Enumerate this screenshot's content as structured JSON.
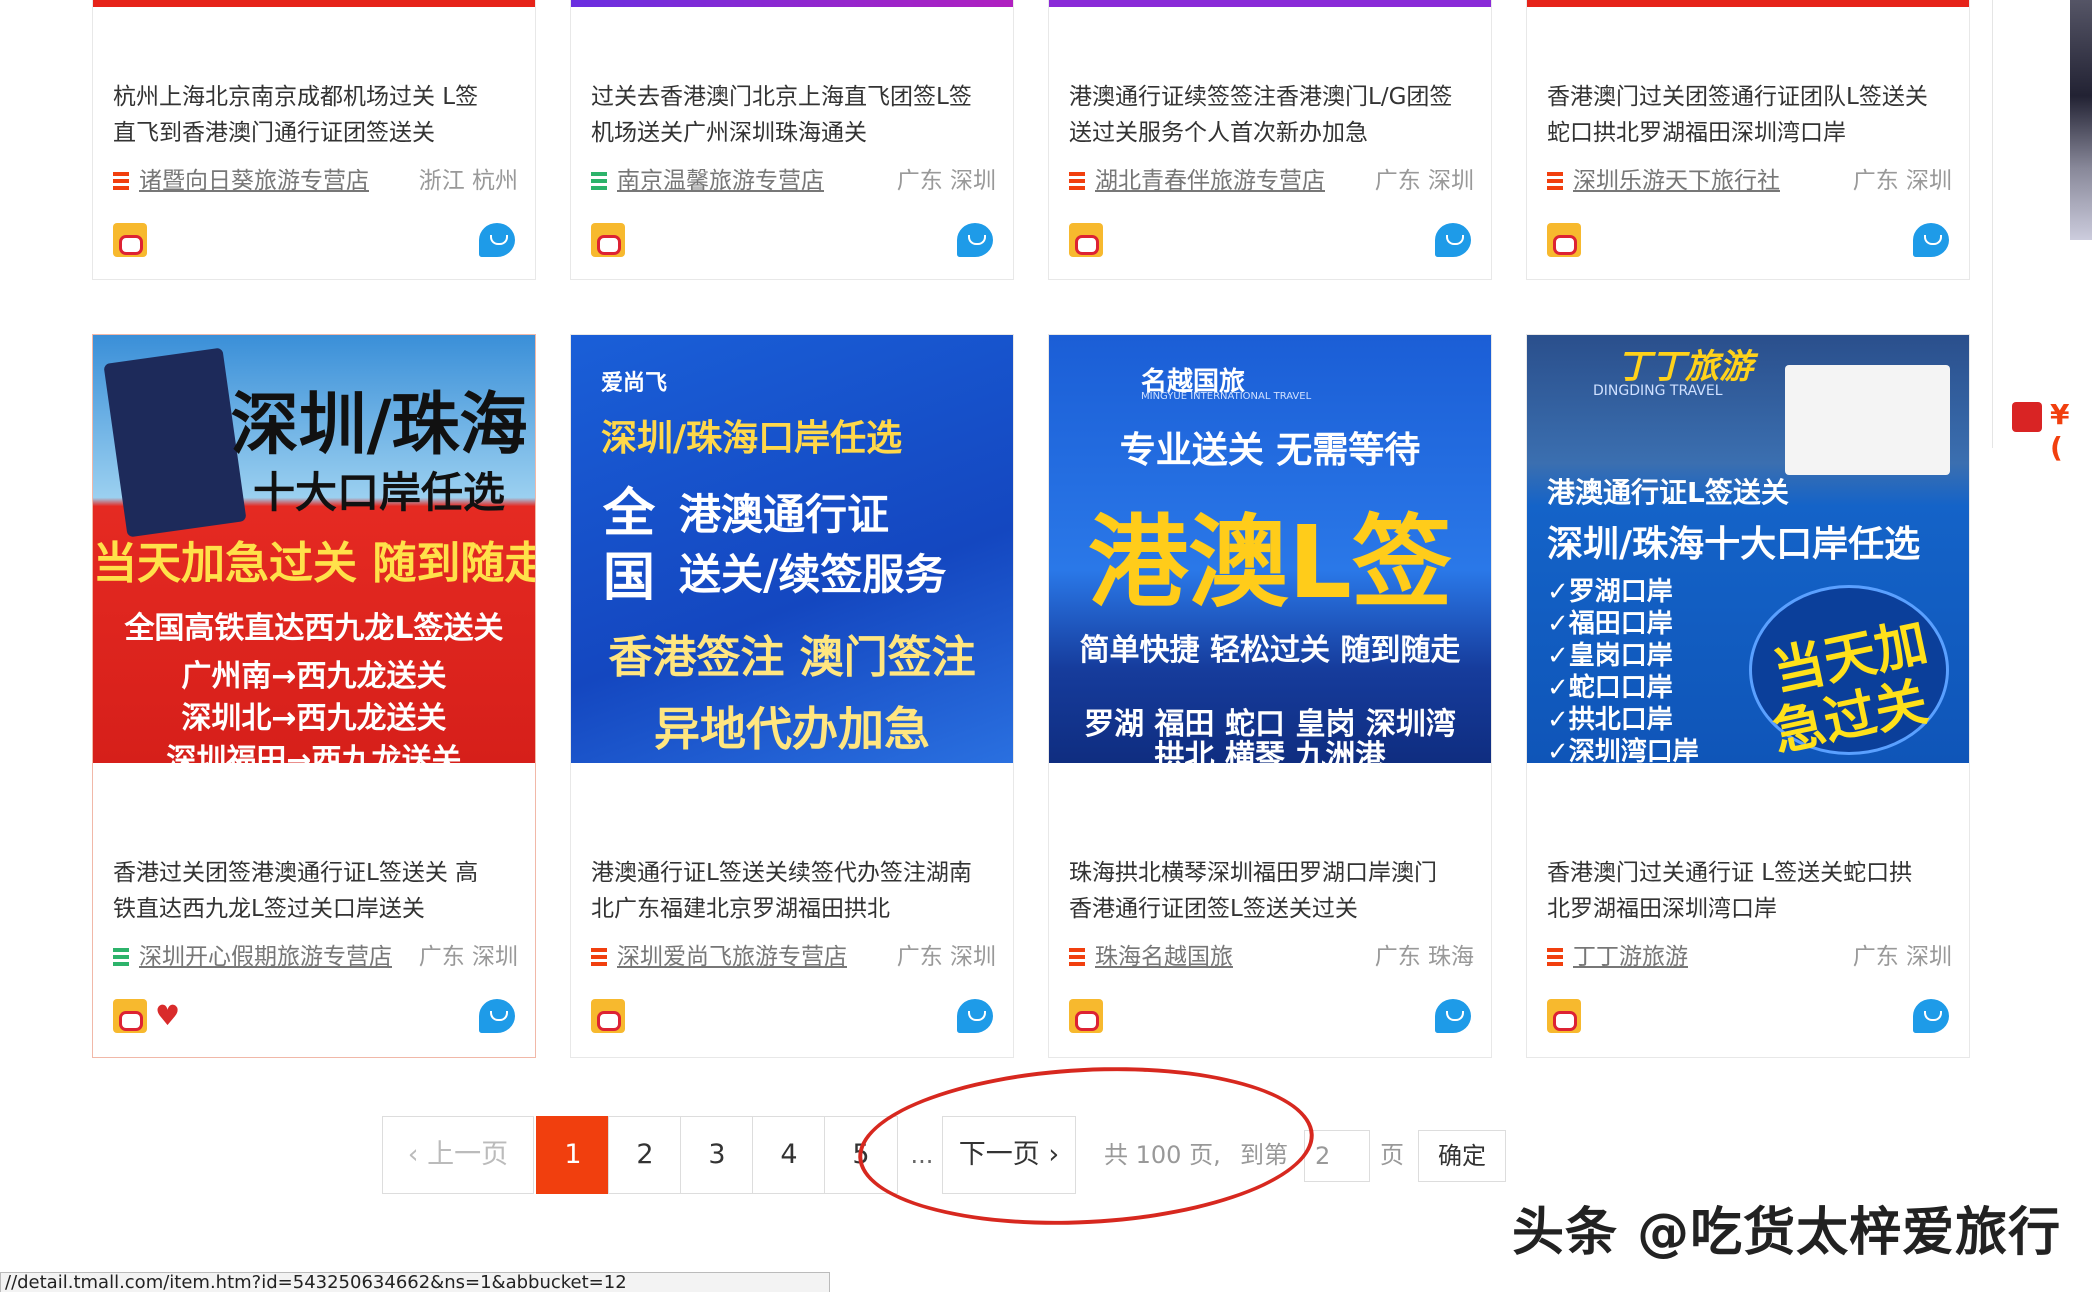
{
  "top_products": [
    {
      "title_line1": "杭州上海北京南京成都机场过关 L签",
      "title_line2": "直飞到香港澳门通行证团签送关",
      "shop": "诸暨向日葵旅游专营店",
      "location": "浙江 杭州",
      "icon_color": "#f13f0e",
      "top_color": "#e62319"
    },
    {
      "title_line1": "过关去香港澳门北京上海直飞团签L签",
      "title_line2": "机场送关广州深圳珠海通关",
      "shop": "南京温馨旅游专营店",
      "location": "广东 深圳",
      "icon_color": "#2db36b",
      "top_color": "#a020c8"
    },
    {
      "title_line1": "港澳通行证续签签注香港澳门L/G团签",
      "title_line2": "送过关服务个人首次新办加急",
      "shop": "湖北青春伴旅游专营店",
      "location": "广东 深圳",
      "icon_color": "#f13f0e",
      "top_color": "#8a2ad8"
    },
    {
      "title_line1": "香港澳门过关团签通行证团队L签送关",
      "title_line2": "蛇口拱北罗湖福田深圳湾口岸",
      "shop": "深圳乐游天下旅行社",
      "location": "广东 深圳",
      "icon_color": "#f13f0e",
      "top_color": "#e62319"
    }
  ],
  "banners": [
    {
      "lines": [
        "深圳/珠海",
        "十大口岸任选",
        "当天加急过关  随到随走",
        "全国高铁直达西九龙L签送关",
        "广州南→西九龙送关",
        "深圳北→西九龙送关",
        "深圳福田→西九龙送关"
      ]
    },
    {
      "lines": [
        "爱尚飞",
        "深圳/珠海口岸任选",
        "全",
        "国",
        "港澳通行证",
        "送关/续签服务",
        "香港签注 澳门签注",
        "异地代办加急"
      ]
    },
    {
      "lines": [
        "名越国旅",
        "MINGYUE INTERNATIONAL TRAVEL",
        "专业送关 无需等待",
        "港澳L签",
        "简单快捷 轻松过关 随到随走",
        "罗湖 福田 蛇口 皇岗 深圳湾",
        "拱北 横琴 九洲港"
      ]
    },
    {
      "lines": [
        "丁丁旅游",
        "DINGDING TRAVEL",
        "港澳通行证L签送关",
        "深圳/珠海十大口岸任选",
        "✓罗湖口岸",
        "✓福田口岸",
        "✓皇岗口岸",
        "✓蛇口口岸",
        "✓拱北口岸",
        "✓深圳湾口岸",
        "当天加",
        "急过关"
      ]
    }
  ],
  "bottom_products": [
    {
      "title_line1": "香港过关团签港澳通行证L签送关 高",
      "title_line2": "铁直达西九龙L签过关口岸送关",
      "shop": "深圳开心假期旅游专营店",
      "location": "广东 深圳",
      "icon_color": "#2db36b"
    },
    {
      "title_line1": "港澳通行证L签送关续签代办签注湖南",
      "title_line2": "北广东福建北京罗湖福田拱北",
      "shop": "深圳爱尚飞旅游专营店",
      "location": "广东 深圳",
      "icon_color": "#f13f0e"
    },
    {
      "title_line1": "珠海拱北横琴深圳福田罗湖口岸澳门",
      "title_line2": "香港通行证团签L签送关过关",
      "shop": "珠海名越国旅",
      "location": "广东 珠海",
      "icon_color": "#f13f0e"
    },
    {
      "title_line1": "香港澳门过关通行证 L签送关蛇口拱",
      "title_line2": "北罗湖福田深圳湾口岸",
      "shop": "丁丁游旅游",
      "location": "广东 深圳",
      "icon_color": "#f13f0e"
    }
  ],
  "pagination": {
    "prev": "‹ 上一页",
    "pages": [
      "1",
      "2",
      "3",
      "4",
      "5"
    ],
    "current": "1",
    "ellipsis": "...",
    "next": "下一页 ›",
    "total": "共 100 页,",
    "goto_label": "到第",
    "goto_value": "2",
    "page_unit": "页",
    "confirm": "确定"
  },
  "side": {
    "price_symbol": "¥ (",
    "price_color": "#f13f0e"
  },
  "watermark": "头条 @吃货太梓爱旅行",
  "status_url": "//detail.tmall.com/item.htm?id=543250634662&ns=1&abbucket=12",
  "colors": {
    "accent": "#f13f0e",
    "link": "#777777",
    "ww_blue": "#1e9be8",
    "annotation_red": "#d7281f"
  }
}
